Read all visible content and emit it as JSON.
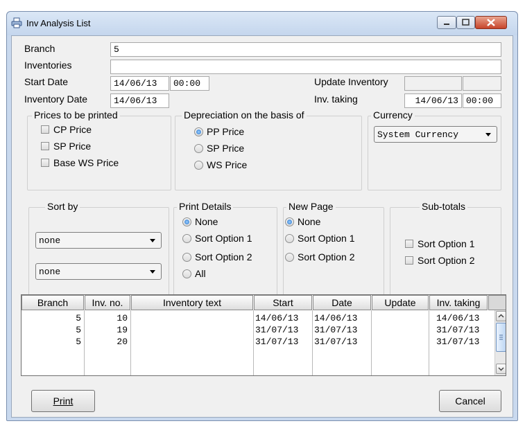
{
  "window": {
    "title": "Inv Analysis List"
  },
  "header": {
    "branch_label": "Branch",
    "branch_value": "5",
    "inventories_label": "Inventories",
    "inventories_value": "",
    "start_date_label": "Start Date",
    "start_date": "14/06/13",
    "start_time": "00:00",
    "update_inventory_label": "Update Inventory",
    "update_inventory_date": "",
    "update_inventory_time": "",
    "inventory_date_label": "Inventory Date",
    "inventory_date": "14/06/13",
    "inv_taking_label": "Inv. taking",
    "inv_taking_date": "14/06/13",
    "inv_taking_time": "00:00"
  },
  "prices": {
    "legend": "Prices to be printed",
    "options": [
      {
        "label": "CP Price",
        "checked": false
      },
      {
        "label": "SP Price",
        "checked": false
      },
      {
        "label": "Base WS Price",
        "checked": false
      }
    ]
  },
  "depreciation": {
    "legend": "Depreciation on the basis of",
    "options": [
      {
        "label": "PP Price",
        "selected": true
      },
      {
        "label": "SP Price",
        "selected": false
      },
      {
        "label": "WS Price",
        "selected": false
      }
    ]
  },
  "currency": {
    "legend": "Currency",
    "selected": "System Currency"
  },
  "sort_by": {
    "legend": "Sort by",
    "first": "none",
    "second": "none"
  },
  "print_details": {
    "legend": "Print Details",
    "options": [
      {
        "label": "None",
        "selected": true
      },
      {
        "label": "Sort Option 1",
        "selected": false
      },
      {
        "label": "Sort Option 2",
        "selected": false
      },
      {
        "label": "All",
        "selected": false
      }
    ]
  },
  "new_page": {
    "legend": "New Page",
    "options": [
      {
        "label": "None",
        "selected": true
      },
      {
        "label": "Sort Option 1",
        "selected": false
      },
      {
        "label": "Sort Option 2",
        "selected": false
      }
    ]
  },
  "subtotals": {
    "legend": "Sub-totals",
    "options": [
      {
        "label": "Sort Option 1",
        "checked": false
      },
      {
        "label": "Sort Option 2",
        "checked": false
      }
    ]
  },
  "table": {
    "columns": [
      "Branch",
      "Inv. no.",
      "Inventory text",
      "Start",
      "Date",
      "Update",
      "Inv. taking"
    ],
    "rows": [
      {
        "branch": "5",
        "inv_no": "10",
        "text": "",
        "start": "14/06/13",
        "date": "14/06/13",
        "update": "",
        "inv_taking": "14/06/13"
      },
      {
        "branch": "5",
        "inv_no": "19",
        "text": "",
        "start": "31/07/13",
        "date": "31/07/13",
        "update": "",
        "inv_taking": "31/07/13"
      },
      {
        "branch": "5",
        "inv_no": "20",
        "text": "",
        "start": "31/07/13",
        "date": "31/07/13",
        "update": "",
        "inv_taking": "31/07/13"
      }
    ]
  },
  "buttons": {
    "print_label": "Print",
    "cancel_label": "Cancel"
  }
}
